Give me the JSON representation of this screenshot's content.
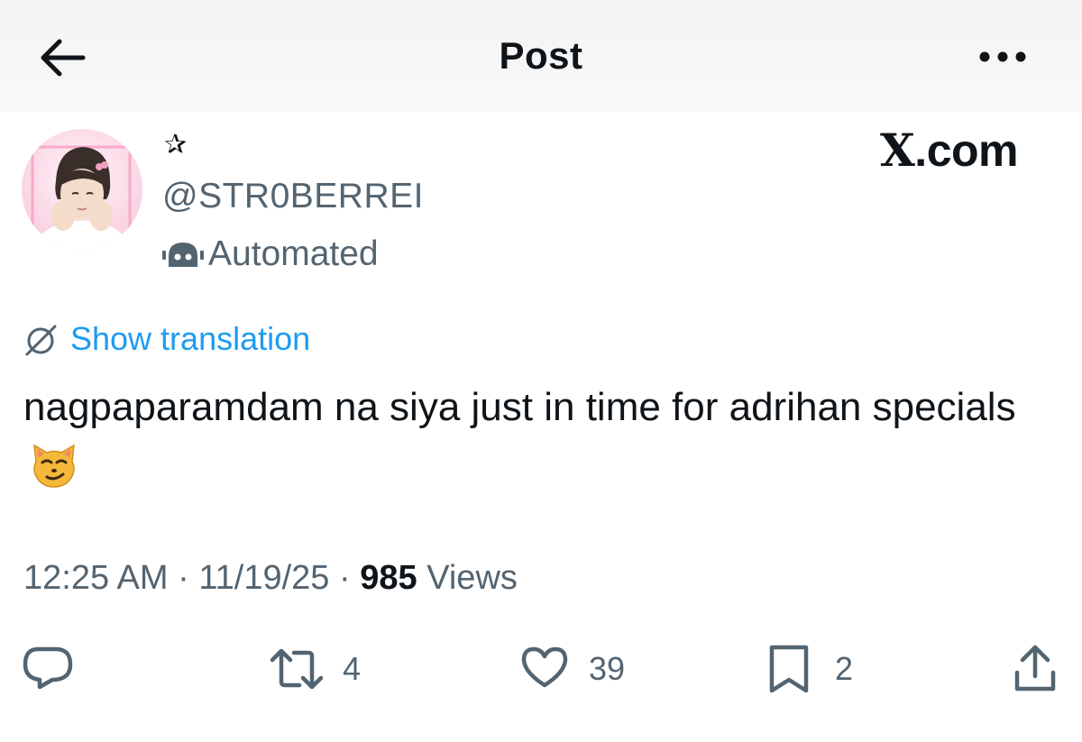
{
  "header": {
    "title": "Post",
    "back_icon": "arrow-left-icon",
    "more_icon": "more-dots-icon"
  },
  "author": {
    "display_name": "✰",
    "handle": "@STR0BERREI",
    "automated_label": "Automated",
    "automated_icon": "robot-icon"
  },
  "watermark": {
    "x": "X",
    "rest": ".com"
  },
  "tweet": {
    "translate_label": "Show translation",
    "text": "nagpaparamdam na siya just in time for adrihan specials",
    "emoji": "smirking-cat-emoji"
  },
  "meta": {
    "time": "12:25 AM",
    "date": "11/19/25",
    "views_count": "985",
    "views_label": "Views",
    "separator": "·"
  },
  "actions": {
    "reposts": "4",
    "likes": "39",
    "bookmarks": "2"
  },
  "colors": {
    "link": "#1d9bf0",
    "secondary_text": "#536471",
    "primary_text": "#0f1419",
    "emoji_face": "#f5b83b"
  }
}
